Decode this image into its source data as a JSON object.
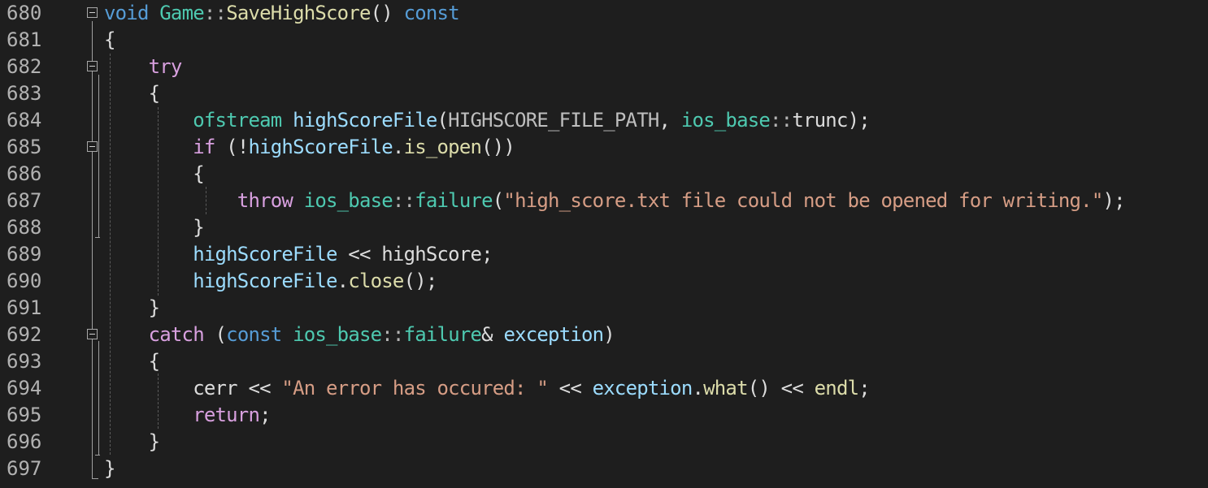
{
  "editor": {
    "lines": [
      {
        "num": "680",
        "tokens": [
          {
            "t": "void",
            "c": "k1"
          },
          {
            "t": " "
          },
          {
            "t": "Game",
            "c": "ty"
          },
          {
            "t": "::",
            "c": "pu"
          },
          {
            "t": "SaveHighScore",
            "c": "fn"
          },
          {
            "t": "() "
          },
          {
            "t": "const",
            "c": "k1"
          }
        ]
      },
      {
        "num": "681",
        "tokens": [
          {
            "t": "{"
          }
        ]
      },
      {
        "num": "682",
        "tokens": [
          {
            "t": "    "
          },
          {
            "t": "try",
            "c": "k2"
          }
        ]
      },
      {
        "num": "683",
        "tokens": [
          {
            "t": "    {"
          }
        ]
      },
      {
        "num": "684",
        "tokens": [
          {
            "t": "        "
          },
          {
            "t": "ofstream",
            "c": "ty"
          },
          {
            "t": " "
          },
          {
            "t": "highScoreFile",
            "c": "va"
          },
          {
            "t": "("
          },
          {
            "t": "HIGHSCORE_FILE_PATH",
            "c": "mac"
          },
          {
            "t": ", "
          },
          {
            "t": "ios_base",
            "c": "ty"
          },
          {
            "t": "::",
            "c": "pu"
          },
          {
            "t": "trunc"
          },
          {
            "t": ");"
          }
        ]
      },
      {
        "num": "685",
        "tokens": [
          {
            "t": "        "
          },
          {
            "t": "if",
            "c": "k2"
          },
          {
            "t": " (!"
          },
          {
            "t": "highScoreFile",
            "c": "va"
          },
          {
            "t": "."
          },
          {
            "t": "is_open",
            "c": "fn"
          },
          {
            "t": "())"
          }
        ]
      },
      {
        "num": "686",
        "tokens": [
          {
            "t": "        {"
          }
        ]
      },
      {
        "num": "687",
        "tokens": [
          {
            "t": "            "
          },
          {
            "t": "throw",
            "c": "k2"
          },
          {
            "t": " "
          },
          {
            "t": "ios_base",
            "c": "ty"
          },
          {
            "t": "::",
            "c": "pu"
          },
          {
            "t": "failure",
            "c": "ty"
          },
          {
            "t": "("
          },
          {
            "t": "\"high_score.txt file could not be opened for writing.\"",
            "c": "st"
          },
          {
            "t": ");"
          }
        ]
      },
      {
        "num": "688",
        "tokens": [
          {
            "t": "        }"
          }
        ]
      },
      {
        "num": "689",
        "tokens": [
          {
            "t": "        "
          },
          {
            "t": "highScoreFile",
            "c": "va"
          },
          {
            "t": " << "
          },
          {
            "t": "highScore"
          },
          {
            "t": ";"
          }
        ]
      },
      {
        "num": "690",
        "tokens": [
          {
            "t": "        "
          },
          {
            "t": "highScoreFile",
            "c": "va"
          },
          {
            "t": "."
          },
          {
            "t": "close",
            "c": "fn"
          },
          {
            "t": "();"
          }
        ]
      },
      {
        "num": "691",
        "tokens": [
          {
            "t": "    }"
          }
        ]
      },
      {
        "num": "692",
        "tokens": [
          {
            "t": "    "
          },
          {
            "t": "catch",
            "c": "k2"
          },
          {
            "t": " ("
          },
          {
            "t": "const",
            "c": "k1"
          },
          {
            "t": " "
          },
          {
            "t": "ios_base",
            "c": "ty"
          },
          {
            "t": "::",
            "c": "pu"
          },
          {
            "t": "failure",
            "c": "ty"
          },
          {
            "t": "& "
          },
          {
            "t": "exception",
            "c": "va"
          },
          {
            "t": ")"
          }
        ]
      },
      {
        "num": "693",
        "tokens": [
          {
            "t": "    {"
          }
        ]
      },
      {
        "num": "694",
        "tokens": [
          {
            "t": "        "
          },
          {
            "t": "cerr"
          },
          {
            "t": " << "
          },
          {
            "t": "\"An error has occured: \"",
            "c": "st"
          },
          {
            "t": " << "
          },
          {
            "t": "exception",
            "c": "va"
          },
          {
            "t": "."
          },
          {
            "t": "what",
            "c": "fn"
          },
          {
            "t": "() << "
          },
          {
            "t": "endl",
            "c": "fn"
          },
          {
            "t": ";"
          }
        ]
      },
      {
        "num": "695",
        "tokens": [
          {
            "t": "        "
          },
          {
            "t": "return",
            "c": "k2"
          },
          {
            "t": ";"
          }
        ]
      },
      {
        "num": "696",
        "tokens": [
          {
            "t": "    }"
          }
        ]
      },
      {
        "num": "697",
        "tokens": [
          {
            "t": "}"
          }
        ]
      }
    ],
    "folds": [
      "680",
      "682",
      "685",
      "692"
    ],
    "colors": {
      "background": "#1e1e1e",
      "line_number": "#b2b2b2",
      "keyword_blue": "#569cd6",
      "keyword_control": "#d8a0df",
      "type": "#4ec9b0",
      "function": "#dcdcaa",
      "variable": "#9cdcfe",
      "string": "#d69d85",
      "default": "#dcdcdc"
    }
  }
}
